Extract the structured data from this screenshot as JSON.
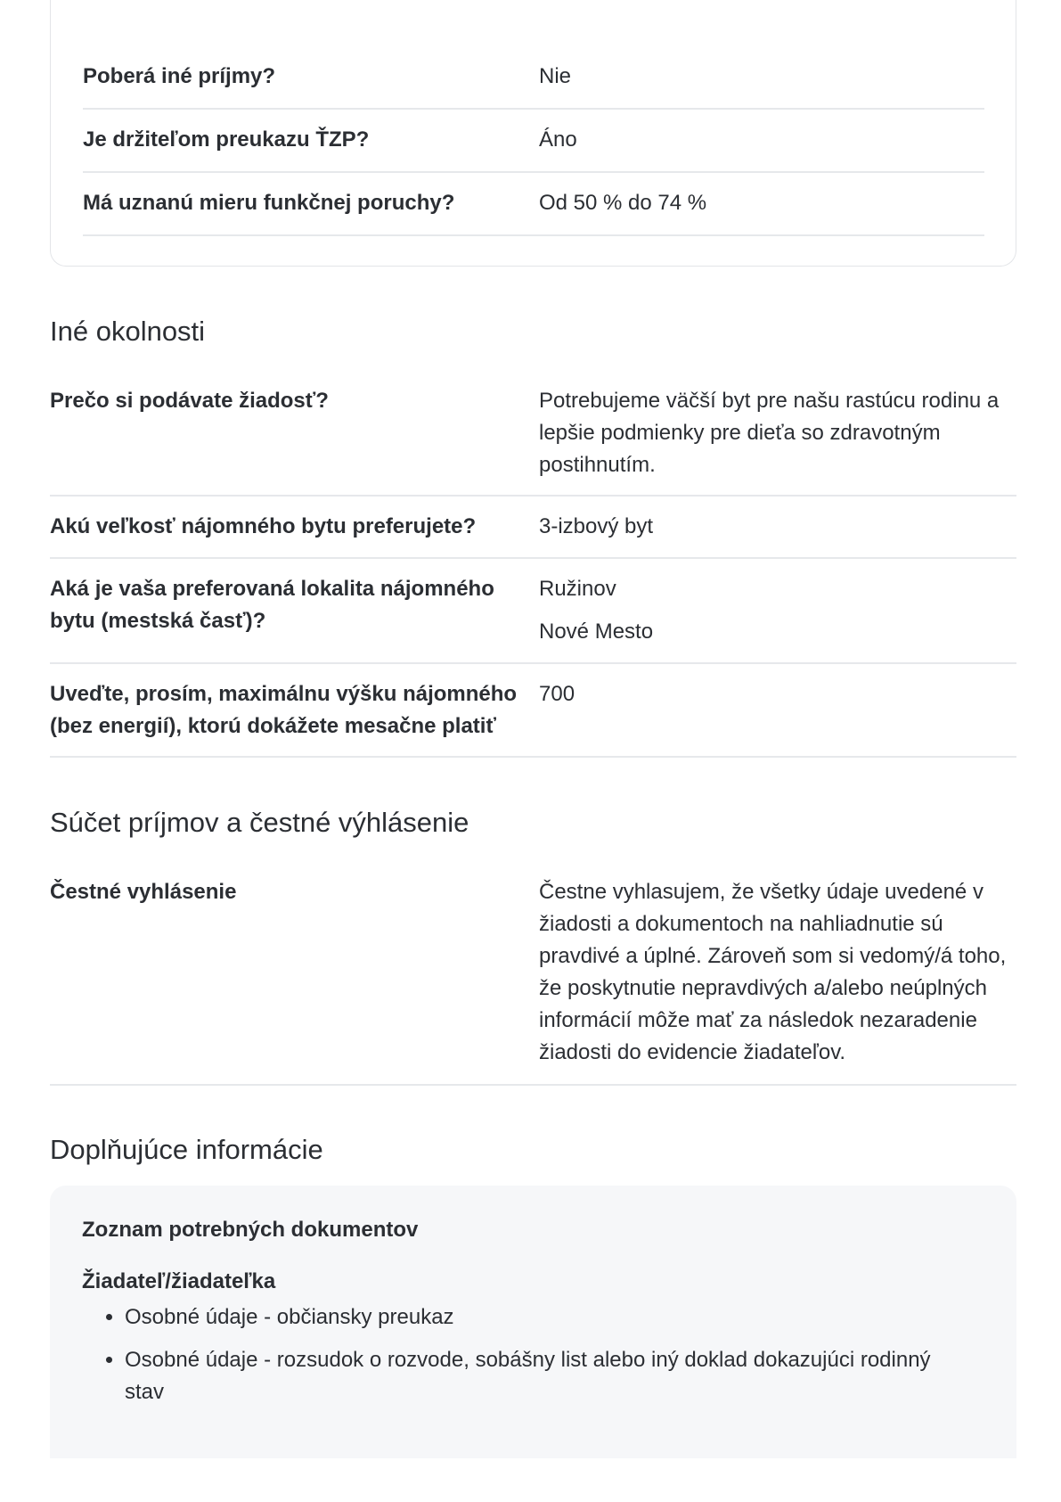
{
  "card": {
    "rows": [
      {
        "question": "Poberá iné príjmy?",
        "answer": "Nie"
      },
      {
        "question": "Je držiteľom preukazu ŤZP?",
        "answer": "Áno"
      },
      {
        "question": "Má uznanú mieru funkčnej poruchy?",
        "answer": "Od 50 % do 74 %"
      }
    ]
  },
  "other": {
    "title": "Iné okolnosti",
    "rows": [
      {
        "question": "Prečo si podávate žiadosť?",
        "answer": "Potrebujeme väčší byt pre našu rastúcu rodinu a lepšie podmienky pre dieťa so zdravotným postihnutím."
      },
      {
        "question": "Akú veľkosť nájomného bytu preferujete?",
        "answer": "3-izbový byt"
      },
      {
        "question": "Aká je vaša preferovaná lokalita nájomného bytu (mestská časť)?",
        "answers": [
          "Ružinov",
          "Nové Mesto"
        ]
      },
      {
        "question": "Uveďte, prosím, maximálnu výšku nájomného (bez energií), ktorú dokážete mesačne platiť",
        "answer": "700"
      }
    ]
  },
  "declaration": {
    "title": "Súčet príjmov a čestné výhlásenie",
    "rows": [
      {
        "question": "Čestné vyhlásenie",
        "answer": "Čestne vyhlasujem, že všetky údaje uvedené v žiadosti a dokumentoch na nahliadnutie sú pravdivé a úplné. Zároveň som si vedomý/á toho, že poskytnutie nepravdivých a/alebo neúplných informácií môže mať za následok nezaradenie žiadosti do evidencie žiadateľov."
      }
    ]
  },
  "additional": {
    "title": "Doplňujúce informácie",
    "box_title": "Zoznam potrebných dokumentov",
    "applicant_label": "Žiadateľ/žiadateľka",
    "documents": [
      "Osobné údaje - občiansky preukaz",
      "Osobné údaje - rozsudok o rozvode, sobášny list alebo iný doklad dokazujúci rodinný stav"
    ]
  }
}
